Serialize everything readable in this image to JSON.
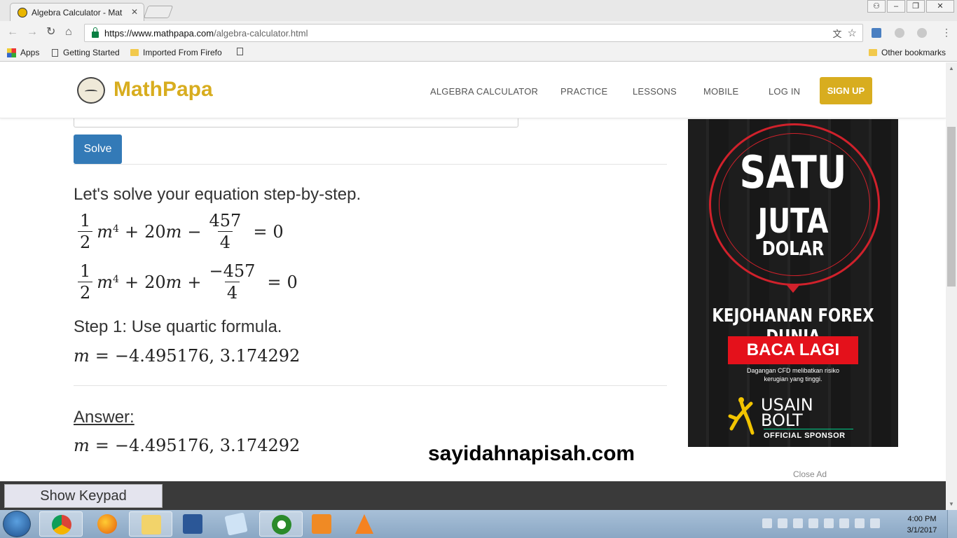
{
  "browser": {
    "tab_title": "Algebra Calculator - Mat",
    "url_host": "https://www.mathpapa.com",
    "url_path": "/algebra-calculator.html",
    "bookmarks": [
      "Apps",
      "Getting Started",
      "Imported From Firefo"
    ],
    "other_bookmarks": "Other bookmarks"
  },
  "site": {
    "logo": "MathPapa",
    "nav": [
      "ALGEBRA CALCULATOR",
      "PRACTICE",
      "LESSONS",
      "MOBILE",
      "LOG IN"
    ],
    "signup": "SIGN UP"
  },
  "solver": {
    "solve_label": "Solve",
    "intro": "Let's solve your equation step-by-step.",
    "eq1": {
      "frac_n": "1",
      "frac_d": "2",
      "var": "m",
      "exp": "4",
      "plus": "+",
      "term2": "20",
      "var2": "m",
      "minus": "−",
      "frac2_n": "457",
      "frac2_d": "4",
      "eq": "=",
      "rhs": "0"
    },
    "eq2": {
      "frac_n": "1",
      "frac_d": "2",
      "var": "m",
      "exp": "4",
      "plus": "+",
      "term2": "20",
      "var2": "m",
      "plus2": "+",
      "frac2_n": "−457",
      "frac2_d": "4",
      "eq": "=",
      "rhs": "0"
    },
    "step1": "Step 1: Use quartic formula.",
    "result_var": "m",
    "result_eq": "=",
    "result": "−4.495176, 3.174292",
    "answer_label": "Answer:",
    "answer_var": "m",
    "answer_eq": "=",
    "answer": "−4.495176, 3.174292"
  },
  "watermark": "sayidahnapisah.com",
  "ad": {
    "line1": "SATU",
    "line2": "JUTA",
    "line3": "DOLAR",
    "headline": "KEJOHANAN FOREX DUNIA",
    "button": "BACA LAGI",
    "disclaimer1": "Dagangan CFD melibatkan risiko",
    "disclaimer2": "kerugian yang tinggi.",
    "brand1": "USAIN",
    "brand2": "BOLT",
    "sponsor": "OFFICIAL SPONSOR",
    "close": "Close Ad",
    "accent": "#d0212b"
  },
  "keypad": "Show Keypad",
  "taskbar": {
    "time": "4:00 PM",
    "date": "3/1/2017"
  }
}
